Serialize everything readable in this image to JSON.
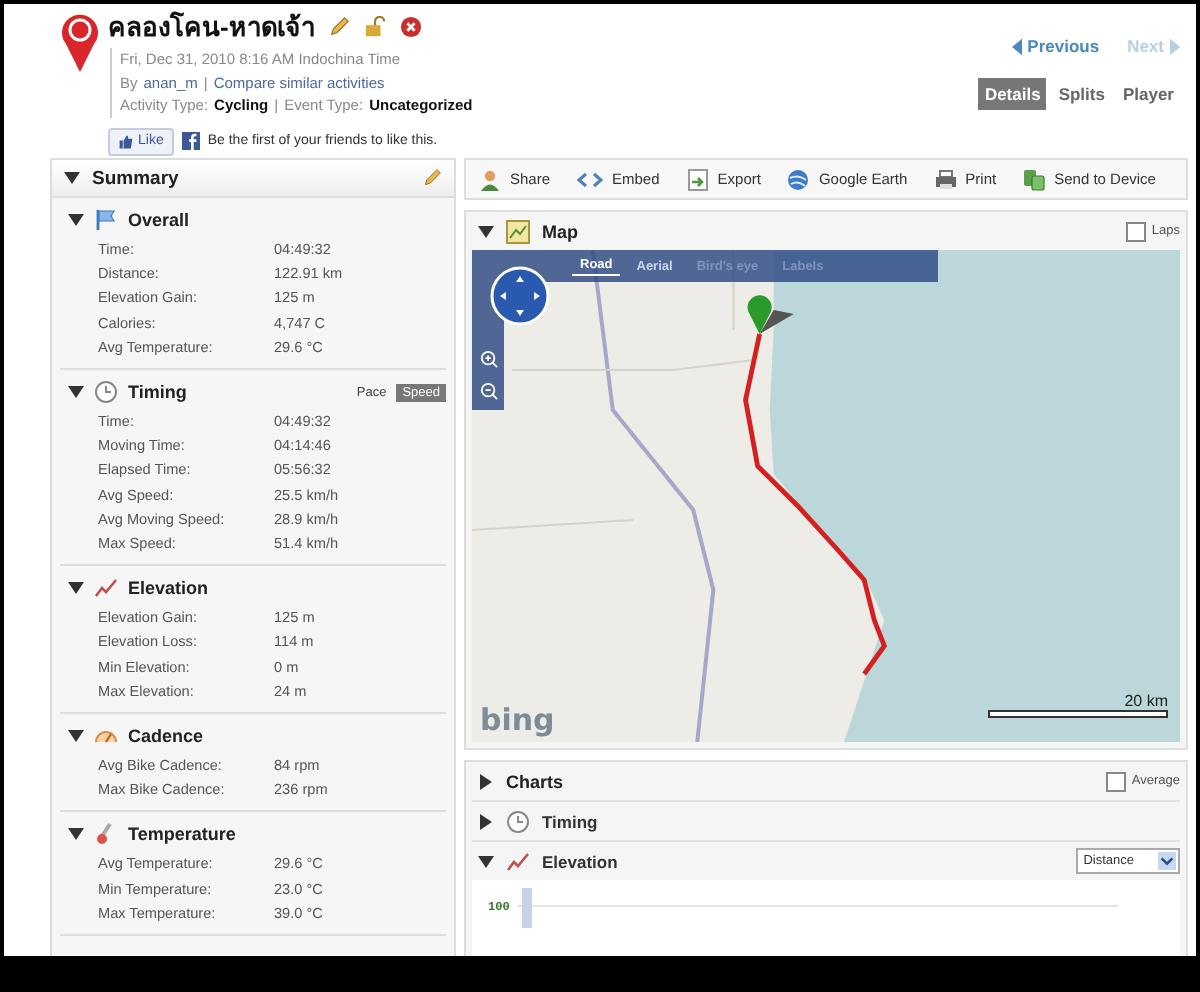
{
  "activity": {
    "title": "คลองโคน-หาดเจ้า",
    "date": "Fri, Dec 31, 2010 8:16 AM Indochina Time",
    "by_label": "By",
    "author": "anan_m",
    "separator": "|",
    "compare_link": "Compare similar activities",
    "activity_type_label": "Activity Type:",
    "activity_type": "Cycling",
    "event_type_label": "Event Type:",
    "event_type": "Uncategorized"
  },
  "like": {
    "button": "Like",
    "text": "Be the first of your friends to like this."
  },
  "pager": [
    {
      "label": "Previous",
      "kind": "prev",
      "disabled": false
    },
    {
      "label": "Next",
      "kind": "next",
      "disabled": true
    }
  ],
  "view_tabs": [
    {
      "label": "Details",
      "selected": true
    },
    {
      "label": "Splits",
      "selected": false
    },
    {
      "label": "Player",
      "selected": false
    }
  ],
  "summary": {
    "title": "Summary",
    "expanded": true,
    "sections": [
      {
        "title": "Overall",
        "expanded": true,
        "rows": [
          {
            "label": "Time:",
            "value": "04:49:32"
          },
          {
            "label": "Distance:",
            "value": "122.91 km"
          },
          {
            "label": "Elevation Gain:",
            "value": "125 m"
          },
          {
            "label": "Calories:",
            "value": "4,747 C"
          },
          {
            "label": "Avg Temperature:",
            "value": "29.6 °C"
          }
        ]
      },
      {
        "title": "Timing",
        "expanded": true,
        "toggle": [
          {
            "label": "Pace",
            "selected": false
          },
          {
            "label": "Speed",
            "selected": true
          }
        ],
        "rows": [
          {
            "label": "Time:",
            "value": "04:49:32"
          },
          {
            "label": "Moving Time:",
            "value": "04:14:46"
          },
          {
            "label": "Elapsed Time:",
            "value": "05:56:32"
          },
          {
            "label": "Avg Speed:",
            "value": "25.5 km/h"
          },
          {
            "label": "Avg Moving Speed:",
            "value": "28.9 km/h"
          },
          {
            "label": "Max Speed:",
            "value": "51.4 km/h"
          }
        ]
      },
      {
        "title": "Elevation",
        "expanded": true,
        "rows": [
          {
            "label": "Elevation Gain:",
            "value": "125 m"
          },
          {
            "label": "Elevation Loss:",
            "value": "114 m"
          },
          {
            "label": "Min Elevation:",
            "value": "0 m"
          },
          {
            "label": "Max Elevation:",
            "value": "24 m"
          }
        ]
      },
      {
        "title": "Cadence",
        "expanded": true,
        "rows": [
          {
            "label": "Avg Bike Cadence:",
            "value": "84 rpm"
          },
          {
            "label": "Max Bike Cadence:",
            "value": "236 rpm"
          }
        ]
      },
      {
        "title": "Temperature",
        "expanded": true,
        "rows": [
          {
            "label": "Avg Temperature:",
            "value": "29.6 °C"
          },
          {
            "label": "Min Temperature:",
            "value": "23.0 °C"
          },
          {
            "label": "Max Temperature:",
            "value": "39.0 °C"
          }
        ]
      }
    ]
  },
  "actions": [
    {
      "label": "Share"
    },
    {
      "label": "Embed"
    },
    {
      "label": "Export"
    },
    {
      "label": "Google Earth"
    },
    {
      "label": "Print"
    },
    {
      "label": "Send to Device"
    }
  ],
  "map": {
    "title": "Map",
    "expanded": true,
    "laps": {
      "label": "Laps",
      "checked": false
    },
    "modes": [
      {
        "label": "Road",
        "selected": true,
        "disabled": false
      },
      {
        "label": "Aerial",
        "selected": false,
        "disabled": false
      },
      {
        "label": "Bird's eye",
        "selected": false,
        "disabled": true
      },
      {
        "label": "Labels",
        "selected": false,
        "disabled": true
      }
    ],
    "logo": "bing",
    "scale": "20 km"
  },
  "charts": {
    "title": "Charts",
    "expanded": false,
    "average": {
      "label": "Average",
      "checked": false
    },
    "items": [
      {
        "title": "Timing",
        "expanded": false
      },
      {
        "title": "Elevation",
        "expanded": true,
        "axis": "Distance",
        "y_tick": "100"
      }
    ]
  }
}
